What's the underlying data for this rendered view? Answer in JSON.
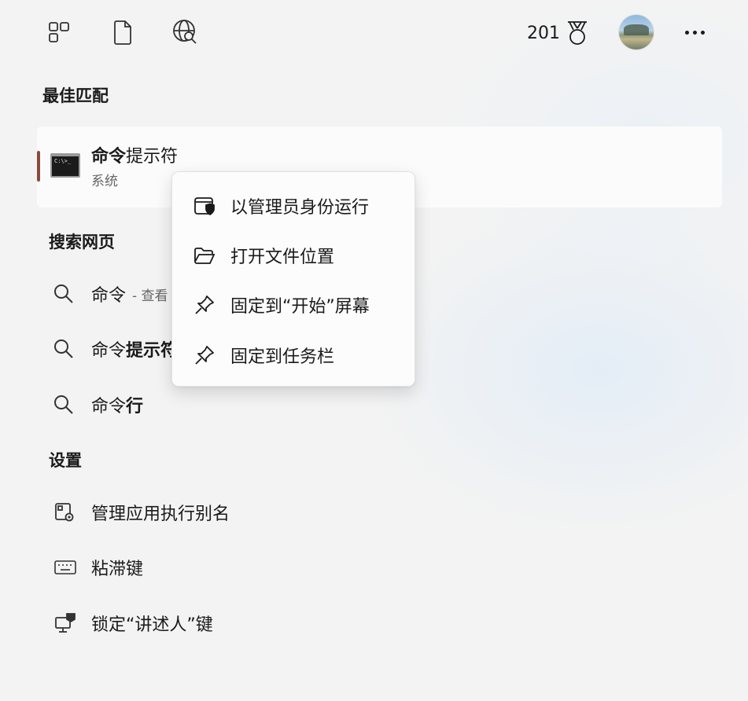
{
  "topbar": {
    "points": "201",
    "icons": [
      "layout-icon",
      "document-icon",
      "web-search-icon",
      "rewards-medal-icon",
      "avatar",
      "more-icon"
    ]
  },
  "best_match": {
    "section_title": "最佳匹配",
    "app_name_bold": "命令",
    "app_name_rest": "提示符",
    "app_type": "系统",
    "accent_color": "#8c4a3e"
  },
  "web_search": {
    "section_title": "搜索网页",
    "items": [
      {
        "prefix": "命令",
        "bold": "",
        "hint": "- 查看"
      },
      {
        "prefix": "命令",
        "bold": "提示符",
        "hint": ""
      },
      {
        "prefix": "命令",
        "bold": "行",
        "hint": ""
      }
    ]
  },
  "settings": {
    "section_title": "设置",
    "items": [
      {
        "label": "管理应用执行别名",
        "icon": "app-alias-settings-icon"
      },
      {
        "label": "粘滞键",
        "icon": "keyboard-icon"
      },
      {
        "label": "锁定“讲述人”键",
        "icon": "narrator-lock-icon"
      }
    ]
  },
  "context_menu": {
    "items": [
      {
        "label": "以管理员身份运行",
        "icon": "run-as-admin-icon"
      },
      {
        "label": "打开文件位置",
        "icon": "folder-open-icon"
      },
      {
        "label": "固定到“开始”屏幕",
        "icon": "pin-icon"
      },
      {
        "label": "固定到任务栏",
        "icon": "pin-icon"
      }
    ]
  }
}
